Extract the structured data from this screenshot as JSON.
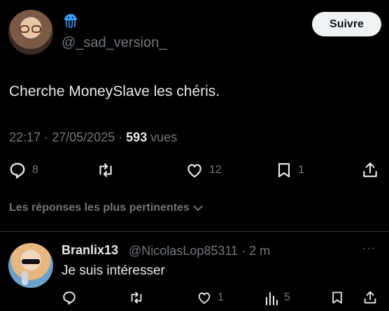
{
  "post": {
    "handle": "@_sad_version_",
    "follow_label": "Suivre",
    "text": "Cherche MoneySlave les chéris.",
    "time": "22:17",
    "date": "27/05/2025",
    "views_count": "593",
    "views_label": "vues",
    "replies_count": "8",
    "likes_count": "12",
    "bookmarks_count": "1",
    "icons": [
      "jellyfish-emoji-icon",
      "reply-icon",
      "retweet-icon",
      "like-icon",
      "bookmark-icon",
      "share-icon"
    ]
  },
  "replies_section": {
    "sort_label": "Les réponses les plus pertinentes"
  },
  "reply": {
    "name": "Branlix13",
    "handle": "@NicolasLop85311",
    "time": "2 m",
    "more": "···",
    "text": "Je suis intéresser",
    "likes_count": "1",
    "views_count": "5"
  },
  "colors": {
    "background": "#000000",
    "text": "#e7e9ea",
    "muted": "#71767b",
    "divider": "#2f3336",
    "follow_button": "#eff3f4"
  }
}
